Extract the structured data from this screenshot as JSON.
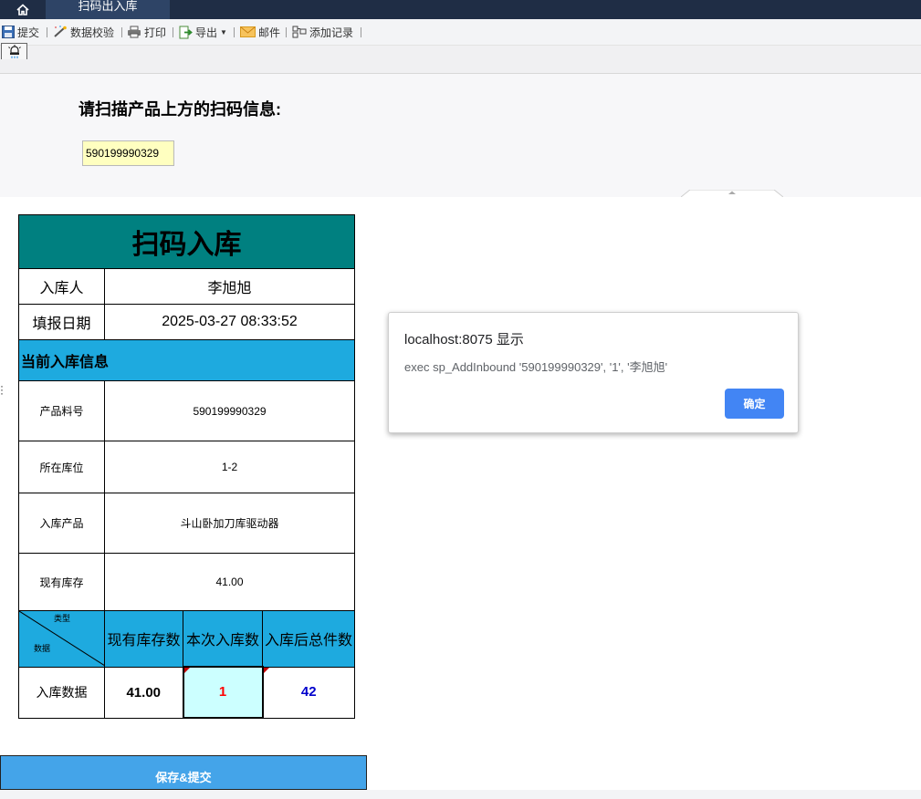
{
  "window": {
    "active_tab": "扫码出入库"
  },
  "toolbar": {
    "submit": "提交",
    "validate": "数据校验",
    "print": "打印",
    "export": "导出",
    "mail": "邮件",
    "add_record": "添加记录"
  },
  "scan": {
    "prompt": "请扫描产品上方的扫码信息:",
    "value": "590199990329"
  },
  "form": {
    "title": "扫码入库",
    "operator_label": "入库人",
    "operator_value": "李旭旭",
    "date_label": "填报日期",
    "date_value": "2025-03-27 08:33:52",
    "section_title": "当前入库信息",
    "fields": [
      {
        "label": "产品料号",
        "value": "590199990329"
      },
      {
        "label": "所在库位",
        "value": "1-2"
      },
      {
        "label": "入库产品",
        "value": "斗山卧加刀库驱动器"
      },
      {
        "label": "现有库存",
        "value": "41.00"
      }
    ],
    "diag_top": "类型",
    "diag_bottom": "数据",
    "col_headers": [
      "现有库存数",
      "本次入库数",
      "入库后总件数"
    ],
    "data_row_label": "入库数据",
    "current_stock": "41.00",
    "inbound_qty": "1",
    "total_after": "42",
    "save_button": "保存&提交"
  },
  "dialog": {
    "title": "localhost:8075 显示",
    "message": "exec sp_AddInbound '590199990329', '1', '李旭旭'",
    "ok_button": "确定"
  },
  "colors": {
    "title_bg": "#008080",
    "section_bg": "#1eaadf",
    "input_bg": "#ffffc0",
    "current_cell_bg": "#ccffff",
    "inbound_text": "#ff0000",
    "total_text": "#0000cc",
    "dialog_ok": "#4285f4"
  }
}
